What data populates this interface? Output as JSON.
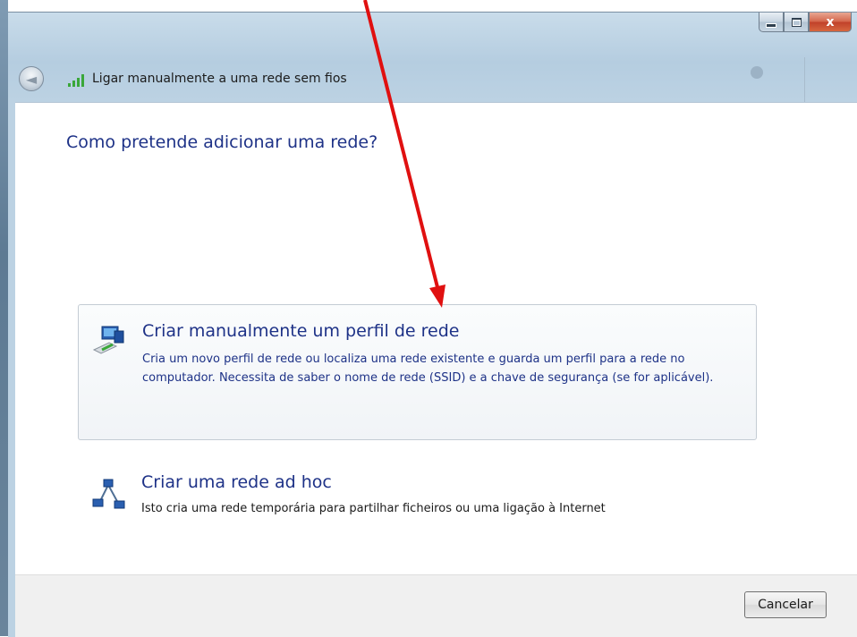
{
  "window": {
    "close_glyph": "x"
  },
  "nav": {
    "title": "Ligar manualmente a uma rede sem fios",
    "back_glyph": "◄"
  },
  "main": {
    "heading": "Como pretende adicionar uma rede?",
    "options": [
      {
        "title": "Criar manualmente um perfil de rede",
        "description": "Cria um novo perfil de rede ou localiza uma rede existente e guarda um perfil para a rede no computador. Necessita de saber o nome de rede (SSID) e a chave de segurança (se for aplicável).",
        "icon": "network-profile-icon"
      },
      {
        "title": "Criar uma rede ad hoc",
        "description": "Isto cria uma rede temporária para partilhar ficheiros ou uma ligação à Internet",
        "icon": "adhoc-network-icon"
      }
    ]
  },
  "footer": {
    "cancel_label": "Cancelar"
  },
  "colors": {
    "link_blue": "#1e3287",
    "annotation_red": "#e01010"
  }
}
